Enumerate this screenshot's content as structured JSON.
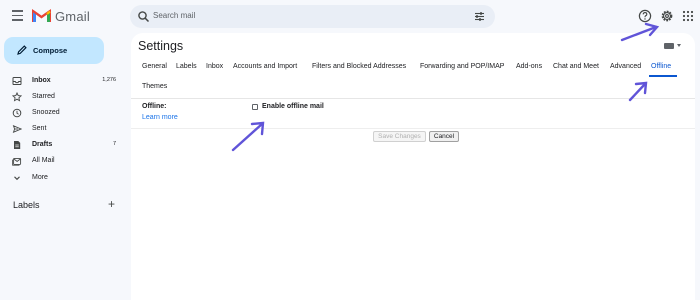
{
  "app": {
    "brand": "Gmail",
    "accent_color": "#0b57d0",
    "annotation_color": "#6054d8"
  },
  "header": {
    "menu_icon": "hamburger-icon",
    "search": {
      "placeholder": "Search mail",
      "icon": "search-icon",
      "filter_icon": "tune-icon"
    },
    "icons": [
      "help-icon",
      "gear-icon",
      "apps-grid-icon"
    ]
  },
  "sidebar": {
    "compose_label": "Compose",
    "items": [
      {
        "label": "Inbox",
        "count": "1,276",
        "icon": "inbox-icon",
        "bold": true
      },
      {
        "label": "Starred",
        "count": "",
        "icon": "star-icon",
        "bold": false
      },
      {
        "label": "Snoozed",
        "count": "",
        "icon": "clock-icon",
        "bold": false
      },
      {
        "label": "Sent",
        "count": "",
        "icon": "send-icon",
        "bold": false
      },
      {
        "label": "Drafts",
        "count": "7",
        "icon": "draft-icon",
        "bold": true
      },
      {
        "label": "All Mail",
        "count": "",
        "icon": "all-mail-icon",
        "bold": false
      },
      {
        "label": "More",
        "count": "",
        "icon": "chevron-down-icon",
        "bold": false
      }
    ],
    "labels_heading": "Labels",
    "labels_add": "+"
  },
  "settings": {
    "title": "Settings",
    "tabs": [
      {
        "label": "General"
      },
      {
        "label": "Labels"
      },
      {
        "label": "Inbox"
      },
      {
        "label": "Accounts and Import"
      },
      {
        "label": "Filters and Blocked Addresses"
      },
      {
        "label": "Forwarding and POP/IMAP"
      },
      {
        "label": "Add-ons"
      },
      {
        "label": "Chat and Meet"
      },
      {
        "label": "Advanced"
      },
      {
        "label": "Offline",
        "active": true
      }
    ],
    "tab_row2": "Themes",
    "offline_label": "Offline:",
    "learn_more": "Learn more",
    "enable_offline_label": "Enable offline mail",
    "enable_offline_checked": false,
    "save_label": "Save Changes",
    "cancel_label": "Cancel"
  }
}
